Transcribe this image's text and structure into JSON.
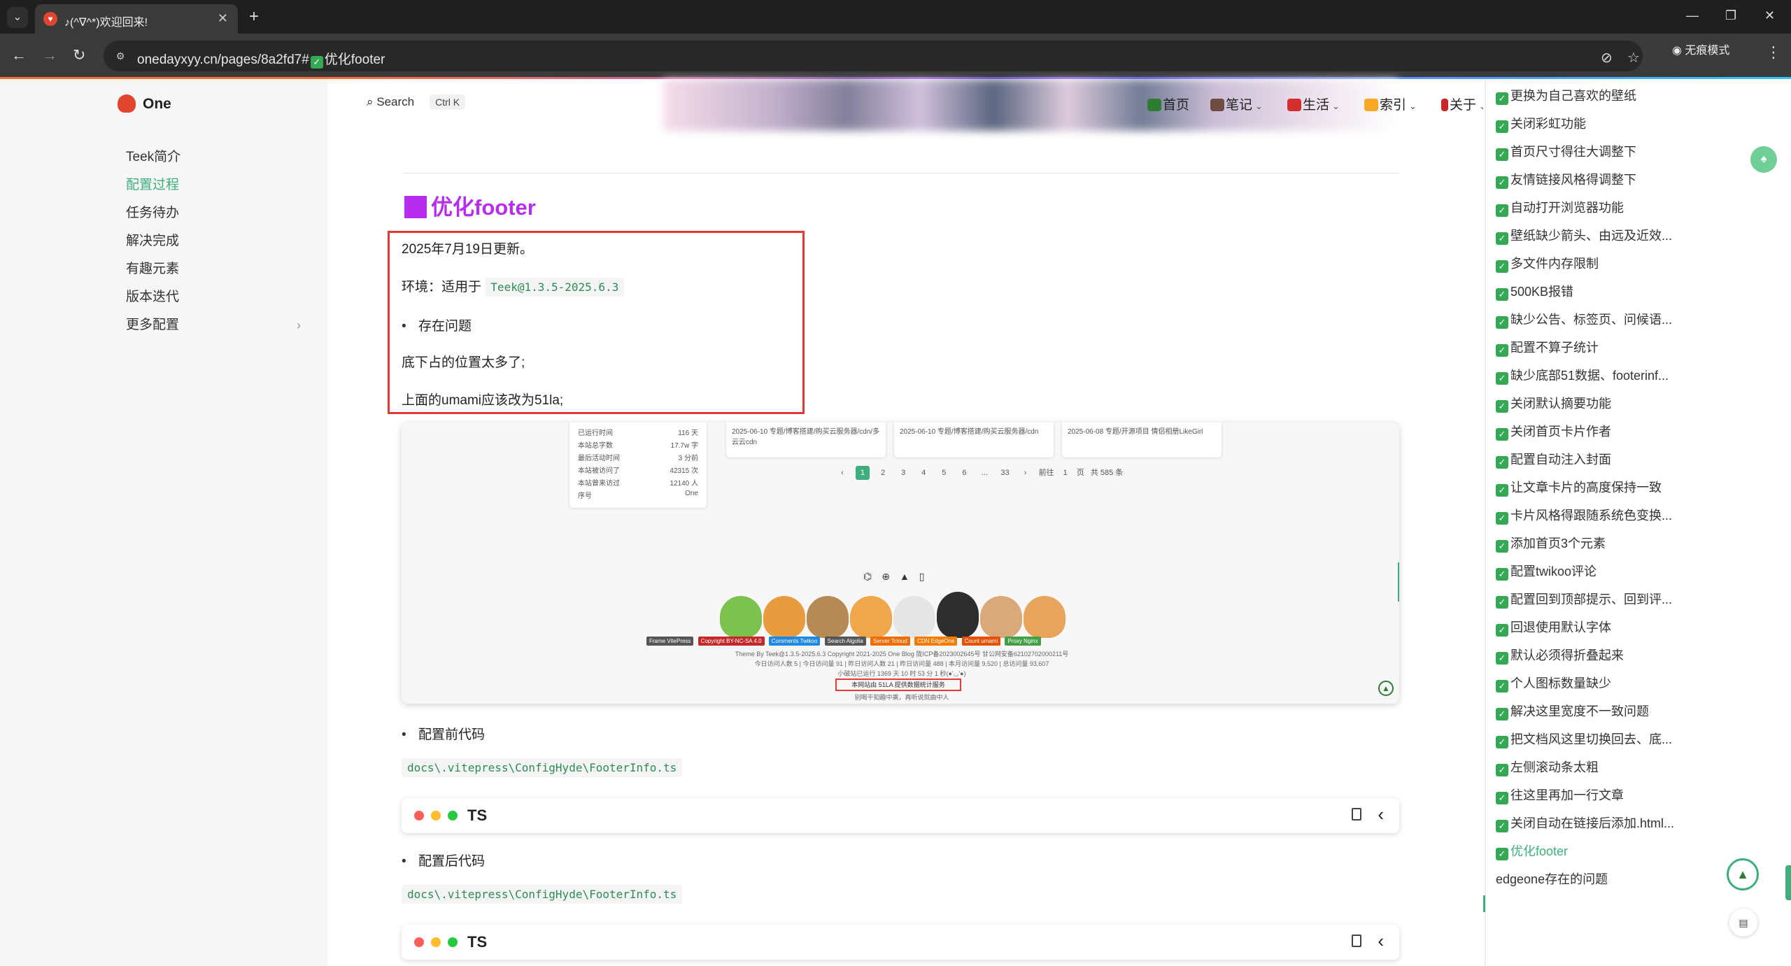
{
  "browser": {
    "tab_title": "♪(^∇^*)欢迎回来!",
    "tab_close": "✕",
    "new_tab": "+",
    "url_prefix": "onedayxyy.cn/pages/8a2fd7#",
    "url_suffix": "优化footer",
    "incognito_label": "无痕模式"
  },
  "site": {
    "logo_text": "One",
    "search_label": "Search",
    "search_shortcut": "Ctrl K"
  },
  "left_nav": [
    {
      "label": "Teek简介",
      "active": false
    },
    {
      "label": "配置过程",
      "active": true
    },
    {
      "label": "任务待办",
      "active": false
    },
    {
      "label": "解决完成",
      "active": false
    },
    {
      "label": "有趣元素",
      "active": false
    },
    {
      "label": "版本迭代",
      "active": false
    },
    {
      "label": "更多配置",
      "active": false,
      "has_children": true
    }
  ],
  "top_nav": [
    {
      "label": "首页",
      "color": "#2e7d32"
    },
    {
      "label": "笔记",
      "color": "#6d4c41"
    },
    {
      "label": "生活",
      "color": "#d32f2f"
    },
    {
      "label": "索引",
      "color": "#f9a825"
    },
    {
      "label": "关于",
      "color": "#c62828"
    }
  ],
  "article": {
    "heading": "优化footer",
    "update_note": "2025年7月19日更新。",
    "env_label": "环境：适用于",
    "env_code": "Teek@1.3.5-2025.6.3",
    "bullet_problem": "存在问题",
    "problem_1": "底下占的位置太多了;",
    "problem_2": "上面的umami应该改为51la;",
    "bullet_before": "配置前代码",
    "path_before": "docs\\.vitepress\\ConfigHyde\\FooterInfo.ts",
    "code_lang_1": "TS",
    "bullet_after": "配置后代码",
    "path_after": "docs\\.vitepress\\ConfigHyde\\FooterInfo.ts",
    "code_lang_2": "TS"
  },
  "screenshot": {
    "stats": [
      {
        "k": "已运行时间",
        "v": "116 天"
      },
      {
        "k": "本站总字数",
        "v": "17.7w 字"
      },
      {
        "k": "最后活动时间",
        "v": "3 分前"
      },
      {
        "k": "本站被访问了",
        "v": "42315 次"
      },
      {
        "k": "本站曾来访过",
        "v": "12140 人"
      },
      {
        "k": "序号",
        "v": "One"
      }
    ],
    "cards": [
      "2025-06-10  专题/博客搭建/购买云服务器/cdn/多云云cdn",
      "2025-06-10  专题/博客搭建/购买云服务器/cdn",
      "2025-06-08  专题/开源项目  情侣相册LikeGirl"
    ],
    "pages": [
      "1",
      "2",
      "3",
      "4",
      "5",
      "6",
      "...",
      "33"
    ],
    "pager_goto": "前往",
    "pager_page": "页",
    "pager_total": "共 585 条",
    "badges": [
      "Frame VitePress",
      "Copyright BY-NC-SA 4.0",
      "Comments Twikoo",
      "Search Algolia",
      "Server Tcloud",
      "CDN EdgeOne",
      "Count umami",
      "Proxy Nginx"
    ],
    "line1": "Theme By Teek@1.3.5-2025.6.3   Copyright 2021-2025 One Blog   陇ICP备2023002645号   甘公网安备62102702000211号",
    "line2": "今日访问人数 5 | 今日访问量 91 | 昨日访问人数 21 | 昨日访问量 488 | 本月访问量 9,520 | 总访问量 93,607",
    "line3": "小破站已运行 1369 天 10 时 53 分 1 秒(●'◡'●)",
    "line4": "本网站由 51LA 提供数据统计服务",
    "line5": "别喝干知趣中乘，再听说就曲中人"
  },
  "outline": [
    "更换为自己喜欢的壁纸",
    "关闭彩虹功能",
    "首页尺寸得往大调整下",
    "友情链接风格得调整下",
    "自动打开浏览器功能",
    "壁纸缺少箭头、由远及近效...",
    "多文件内存限制",
    "500KB报错",
    "缺少公告、标签页、问候语...",
    "配置不算子统计",
    "缺少底部51数据、footerinf...",
    "关闭默认摘要功能",
    "关闭首页卡片作者",
    "配置自动注入封面",
    "让文章卡片的高度保持一致",
    "卡片风格得跟随系统色变换...",
    "添加首页3个元素",
    "配置twikoo评论",
    "配置回到顶部提示、回到评...",
    "回退使用默认字体",
    "默认必须得折叠起来",
    "个人图标数量缺少",
    "解决这里宽度不一致问题",
    "把文档风这里切换回去、底...",
    "左侧滚动条太粗",
    "往这里再加一行文章",
    "关闭自动在链接后添加.html...",
    "优化footer",
    "edgeone存在的问题"
  ],
  "outline_active_index": 27
}
